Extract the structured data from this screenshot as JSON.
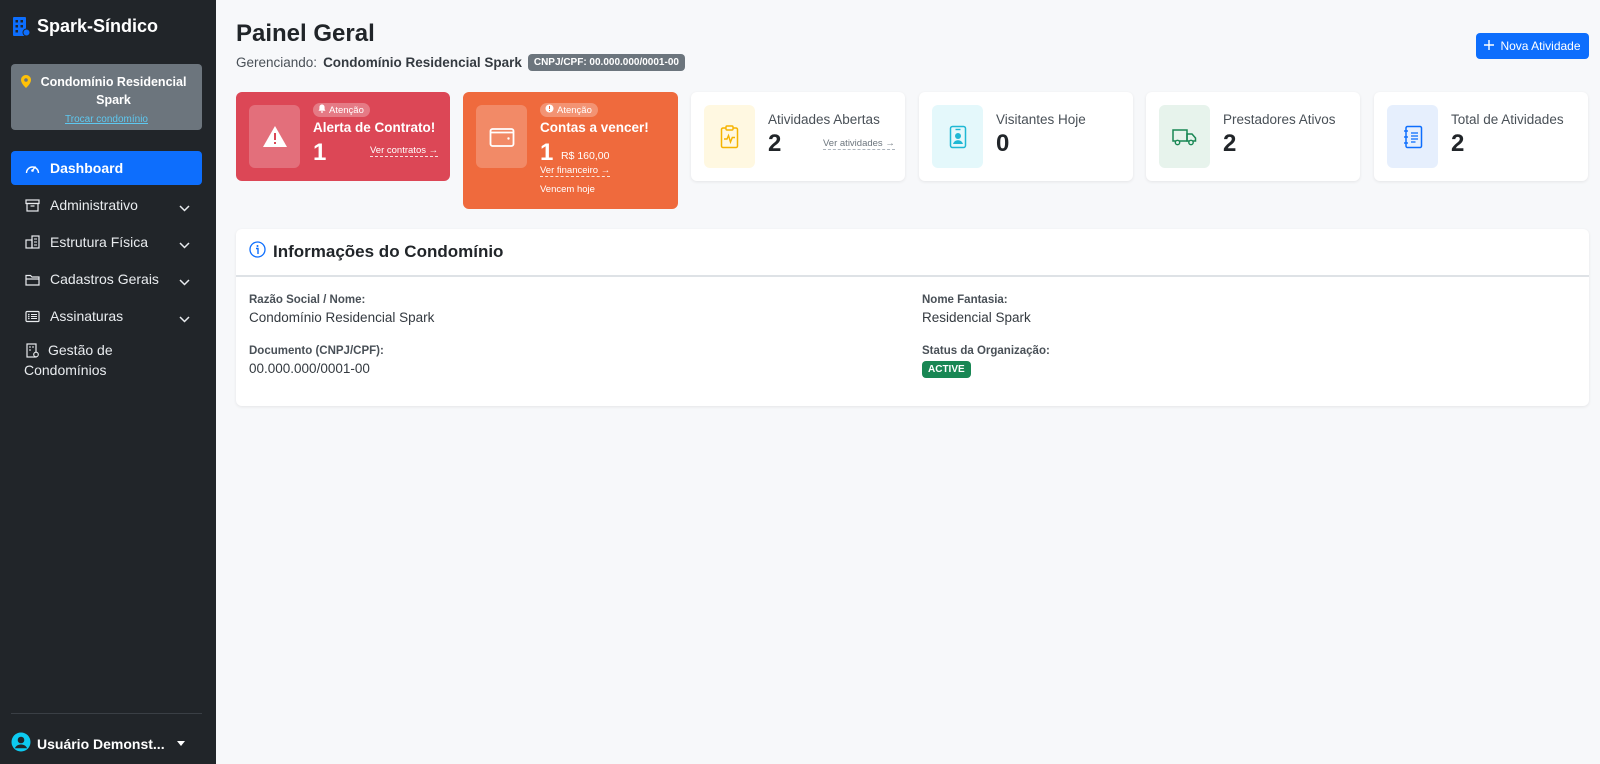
{
  "app": {
    "brand": "Spark-Síndico"
  },
  "sidebar": {
    "condo_name": "Condomínio Residencial Spark",
    "switch_label": "Trocar condomínio",
    "items": [
      {
        "label": "Dashboard",
        "icon": "speedometer-icon",
        "active": true
      },
      {
        "label": "Administrativo",
        "icon": "archive-icon",
        "expandable": true
      },
      {
        "label": "Estrutura Física",
        "icon": "buildings-icon",
        "expandable": true
      },
      {
        "label": "Cadastros Gerais",
        "icon": "folder-icon",
        "expandable": true
      },
      {
        "label": "Assinaturas",
        "icon": "card-list-icon",
        "expandable": true
      },
      {
        "label": "Gestão de Condomínios",
        "icon": "building-gear-icon"
      }
    ],
    "user_name": "Usuário Demonst..."
  },
  "header": {
    "title": "Painel Geral",
    "managing_prefix": "Gerenciando:",
    "managing_name": "Condomínio Residencial Spark",
    "cnpj_badge": "CNPJ/CPF: 00.000.000/0001-00",
    "new_activity_label": "Nova Atividade"
  },
  "alerts": [
    {
      "badge": "Atenção",
      "title": "Alerta de Contrato!",
      "count": "1",
      "link": "Ver contratos →",
      "color": "#dc4756"
    },
    {
      "badge": "Atenção",
      "title": "Contas a vencer!",
      "count": "1",
      "amount": "R$ 160,00",
      "link": "Ver financeiro →",
      "due": "Vencem hoje",
      "color": "#ef6a3d"
    }
  ],
  "stats": [
    {
      "label": "Atividades Abertas",
      "value": "2",
      "link": "Ver atividades →",
      "icon": "clipboard-pulse-icon",
      "bg": "#fff8e1",
      "color": "#f5b301"
    },
    {
      "label": "Visitantes Hoje",
      "value": "0",
      "icon": "person-badge-icon",
      "bg": "#e4f8fb",
      "color": "#1fb8d4"
    },
    {
      "label": "Prestadores Ativos",
      "value": "2",
      "icon": "truck-icon",
      "bg": "#e7f3ec",
      "color": "#198754"
    },
    {
      "label": "Total de Atividades",
      "value": "2",
      "icon": "journal-text-icon",
      "bg": "#e6effd",
      "color": "#0d6efd"
    }
  ],
  "info": {
    "title": "Informações do Condomínio",
    "razao_label": "Razão Social / Nome:",
    "razao_value": "Condomínio Residencial Spark",
    "fantasia_label": "Nome Fantasia:",
    "fantasia_value": "Residencial Spark",
    "documento_label": "Documento (CNPJ/CPF):",
    "documento_value": "00.000.000/0001-00",
    "status_label": "Status da Organização:",
    "status_value": "ACTIVE"
  }
}
